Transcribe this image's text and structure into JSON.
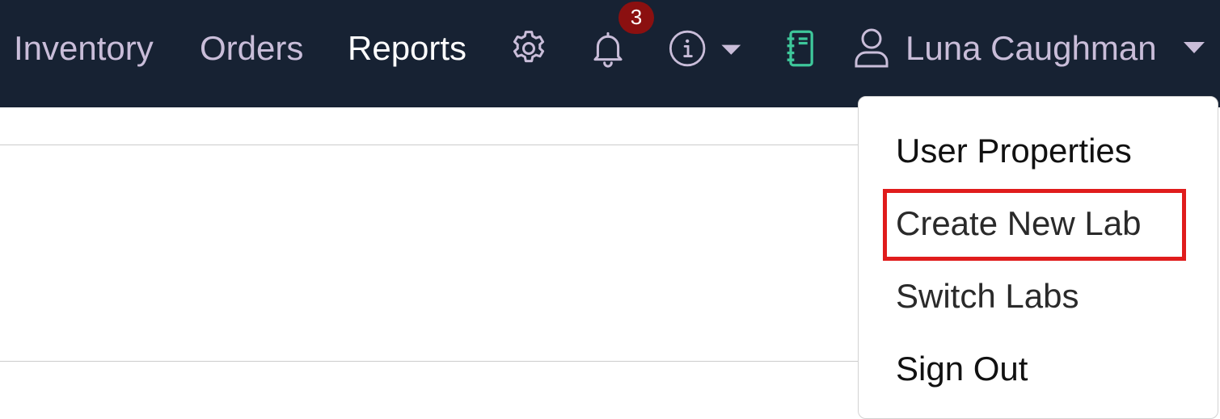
{
  "nav": {
    "links": [
      "Inventory",
      "Orders",
      "Reports"
    ],
    "active": "Reports"
  },
  "icons": {
    "settings": "gear-icon",
    "notifications": "bell-icon",
    "info": "info-circle-icon",
    "notebook": "notebook-icon",
    "user": "user-icon"
  },
  "notifications": {
    "count": "3"
  },
  "user": {
    "name": "Luna Caughman"
  },
  "user_menu": {
    "items": [
      "User Properties",
      "Create New Lab",
      "Switch Labs",
      "Sign Out"
    ],
    "highlighted": "Create New Lab"
  },
  "colors": {
    "topbar_bg": "#172233",
    "nav_text": "#c9bdd9",
    "active_nav_text": "#ffffff",
    "badge_bg": "#8b1010",
    "notebook_icon": "#3ec79a",
    "highlight_border": "#e01c1c"
  }
}
